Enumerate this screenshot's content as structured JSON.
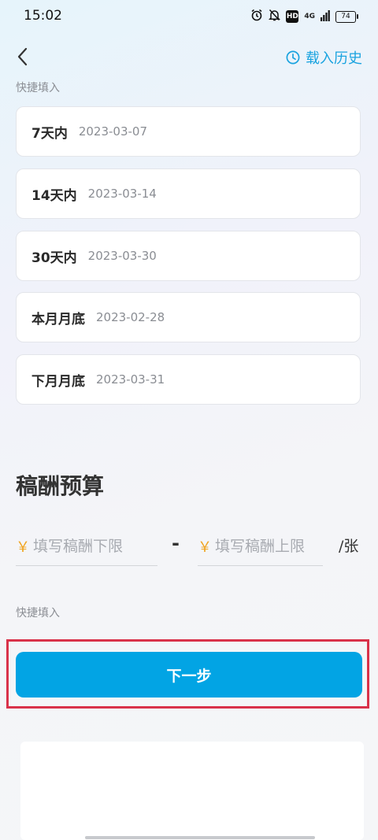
{
  "status_bar": {
    "time": "15:02",
    "network": "4G",
    "battery": "74",
    "icons": [
      "alarm-icon",
      "bell-muted-icon",
      "hd-icon",
      "signal-icon",
      "battery-icon"
    ]
  },
  "header": {
    "history_label": "载入历史"
  },
  "deadline": {
    "quick_fill_label": "快捷填入",
    "options": [
      {
        "label": "7天内",
        "date": "2023-03-07"
      },
      {
        "label": "14天内",
        "date": "2023-03-14"
      },
      {
        "label": "30天内",
        "date": "2023-03-30"
      },
      {
        "label": "本月月底",
        "date": "2023-02-28"
      },
      {
        "label": "下月月底",
        "date": "2023-03-31"
      }
    ]
  },
  "budget": {
    "title": "稿酬预算",
    "currency_symbol": "￥",
    "min_placeholder": "填写稿酬下限",
    "min_value": "",
    "max_placeholder": "填写稿酬上限",
    "max_value": "",
    "separator": "-",
    "unit": "/张",
    "quick_fill_label": "快捷填入"
  },
  "actions": {
    "next_label": "下一步"
  },
  "colors": {
    "accent": "#02a4e4",
    "link": "#1aa3df",
    "currency": "#f0a31e",
    "highlight_outline": "#d9324a"
  }
}
